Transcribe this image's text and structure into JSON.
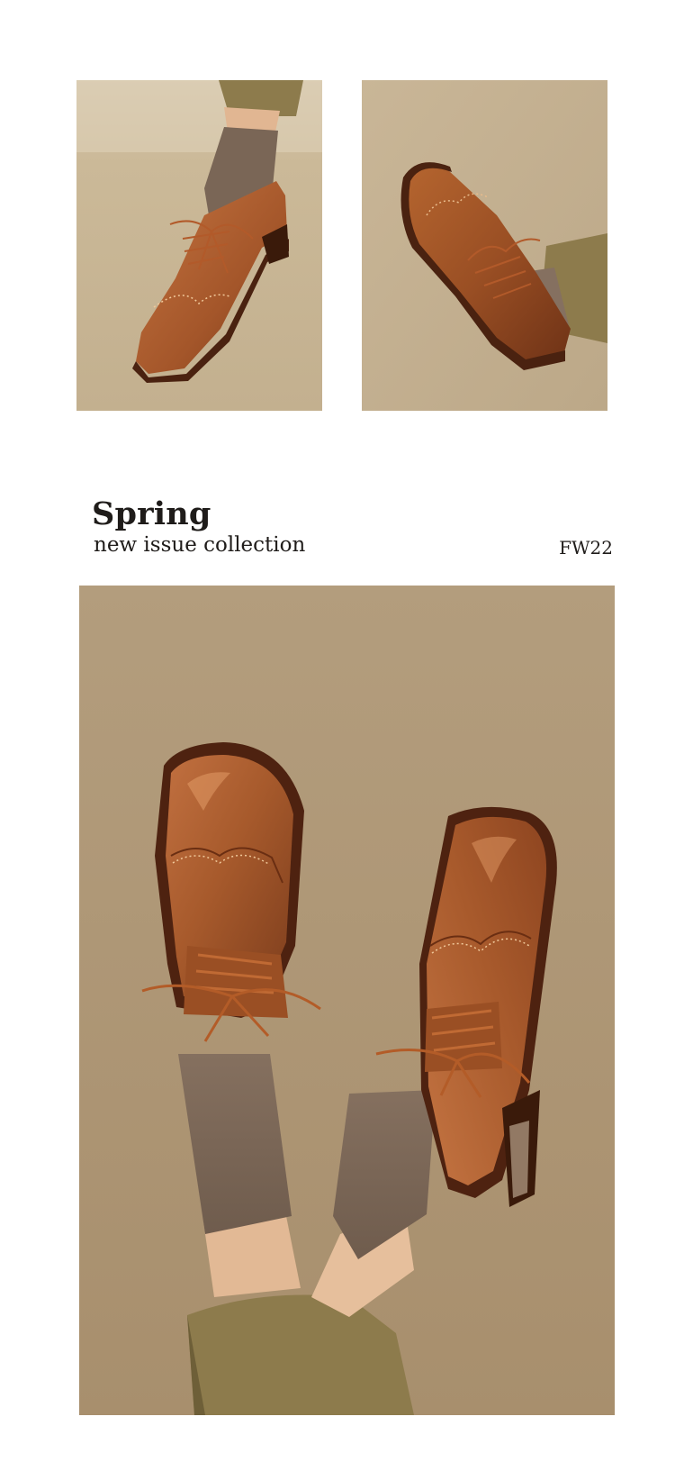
{
  "header": {
    "title": "Spring",
    "subtitle": "new issue collection",
    "season_code": "FW22"
  },
  "images": [
    {
      "subject": "brown-brogue-oxford-shoe-side-view"
    },
    {
      "subject": "brown-brogue-oxford-shoe-top-view"
    },
    {
      "subject": "pair-of-brown-brogue-oxford-shoes-raised"
    }
  ],
  "colors": {
    "background": "#ffffff",
    "text": "#1f1c1a",
    "backdrop": "#b09878",
    "leather": "#a4582a",
    "sole": "#5a2a14",
    "sock": "#7a6656",
    "trouser": "#8d7b4c"
  }
}
